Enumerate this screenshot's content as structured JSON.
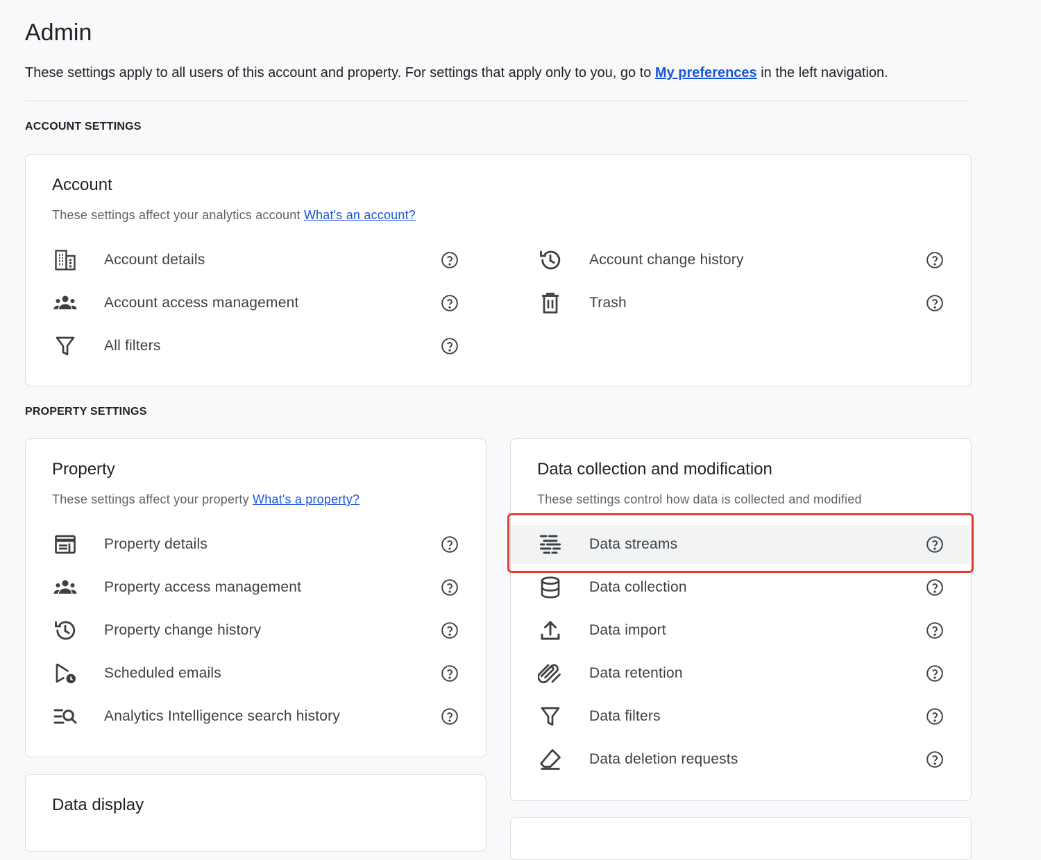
{
  "page": {
    "title": "Admin",
    "intro_before": "These settings apply to all users of this account and property. For settings that apply only to you, go to ",
    "intro_link": "My preferences",
    "intro_after": " in the left navigation."
  },
  "sections": {
    "account_settings": "ACCOUNT SETTINGS",
    "property_settings": "PROPERTY SETTINGS"
  },
  "account_card": {
    "title": "Account",
    "subtitle": "These settings affect your analytics account ",
    "subtitle_link": "What's an account?",
    "items": [
      {
        "label": "Account details",
        "icon": "building-icon"
      },
      {
        "label": "Account access management",
        "icon": "people-icon"
      },
      {
        "label": "All filters",
        "icon": "filter-icon"
      },
      {
        "label": "Account change history",
        "icon": "history-icon"
      },
      {
        "label": "Trash",
        "icon": "trash-icon"
      }
    ]
  },
  "property_card": {
    "title": "Property",
    "subtitle": "These settings affect your property ",
    "subtitle_link": "What's a property?",
    "items": [
      {
        "label": "Property details",
        "icon": "property-card-icon"
      },
      {
        "label": "Property access management",
        "icon": "people-icon"
      },
      {
        "label": "Property change history",
        "icon": "history-icon"
      },
      {
        "label": "Scheduled emails",
        "icon": "scheduled-email-icon"
      },
      {
        "label": "Analytics Intelligence search history",
        "icon": "search-list-icon"
      }
    ]
  },
  "data_card": {
    "title": "Data collection and modification",
    "subtitle": "These settings control how data is collected and modified",
    "items": [
      {
        "label": "Data streams",
        "icon": "data-streams-icon",
        "highlighted": true
      },
      {
        "label": "Data collection",
        "icon": "database-icon"
      },
      {
        "label": "Data import",
        "icon": "upload-icon"
      },
      {
        "label": "Data retention",
        "icon": "retention-icon"
      },
      {
        "label": "Data filters",
        "icon": "filter-icon"
      },
      {
        "label": "Data deletion requests",
        "icon": "eraser-icon"
      }
    ]
  },
  "display_card": {
    "title": "Data display"
  },
  "colors": {
    "link": "#1a56d8",
    "highlight_border": "#e53f2e",
    "row_highlight": "#f1f3f4"
  }
}
